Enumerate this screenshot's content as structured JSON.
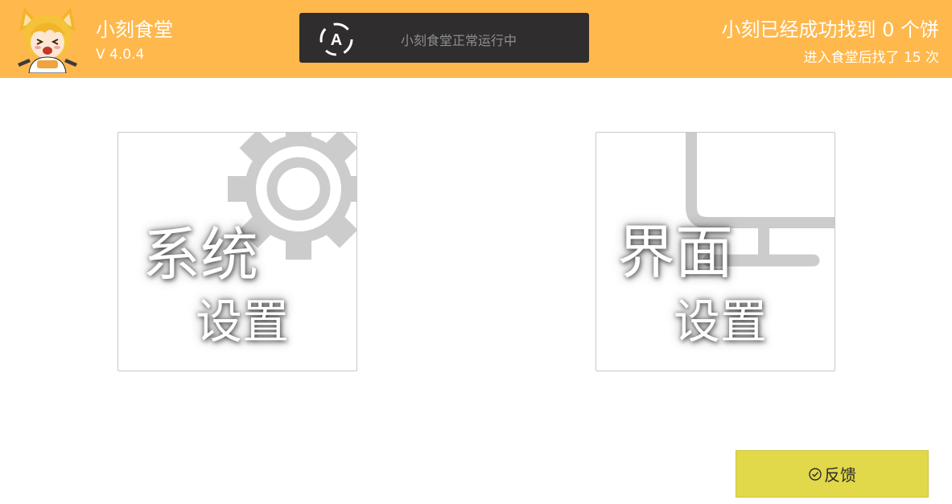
{
  "header": {
    "app_name": "小刻食堂",
    "version": "V 4.0.4",
    "status": "小刻食堂正常运行中",
    "status_logo_letter": "A",
    "found_text": "小刻已经成功找到 0 个饼",
    "visits_text": "进入食堂后找了 15 次"
  },
  "tiles": {
    "system": {
      "title": "系统",
      "subtitle": "设置",
      "icon": "gear-icon"
    },
    "ui": {
      "title": "界面",
      "subtitle": "设置",
      "icon": "monitor-icon"
    }
  },
  "feedback": {
    "label": "反馈",
    "icon": "check-circle-icon"
  },
  "colors": {
    "header_bg": "#ffb84c",
    "status_bg": "#2f2d2e",
    "feedback_bg": "#e1d84a",
    "tile_icon": "#cccccc"
  }
}
